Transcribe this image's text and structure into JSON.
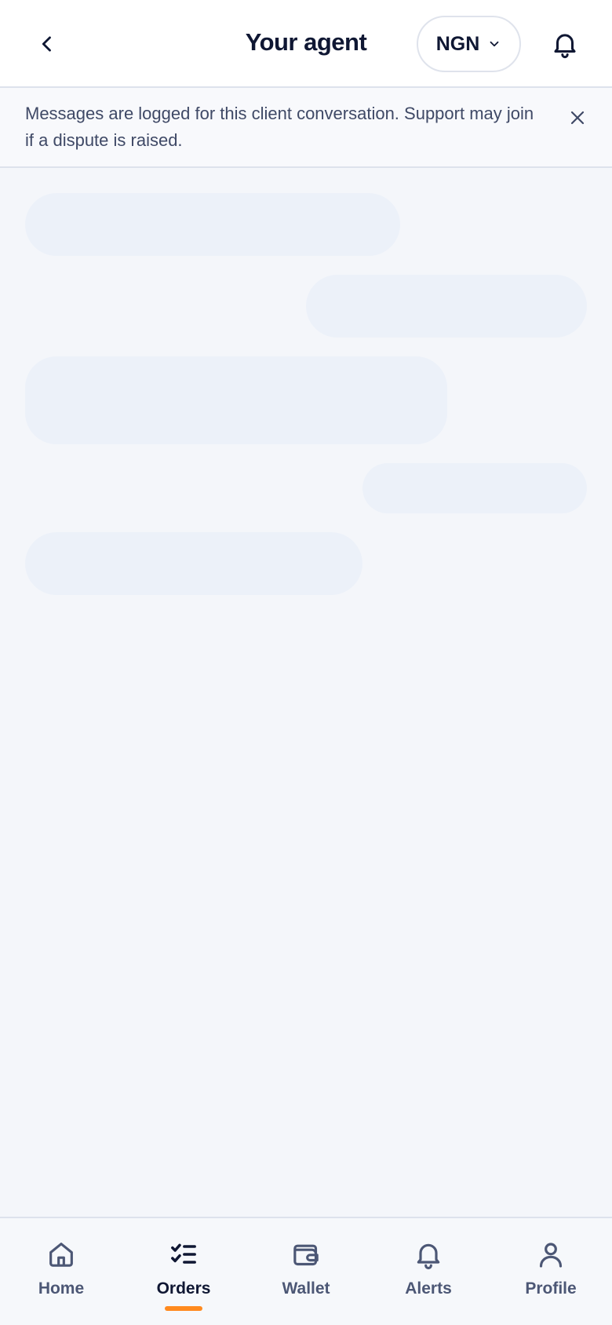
{
  "header": {
    "title": "Your agent",
    "currency": "NGN",
    "back_icon": "chevron-left-icon",
    "bell_icon": "bell-icon"
  },
  "notice": {
    "text": "Messages are logged for this client conversation. Support may join if a dispute is raised.",
    "close_icon": "close-icon"
  },
  "nav": {
    "items": [
      {
        "label": "Home",
        "icon": "home-icon"
      },
      {
        "label": "Orders",
        "icon": "checklist-icon"
      },
      {
        "label": "Wallet",
        "icon": "wallet-icon"
      },
      {
        "label": "Alerts",
        "icon": "bell-icon"
      },
      {
        "label": "Profile",
        "icon": "user-icon"
      }
    ],
    "active": "Orders",
    "accent_color": "#ff8a1f"
  }
}
